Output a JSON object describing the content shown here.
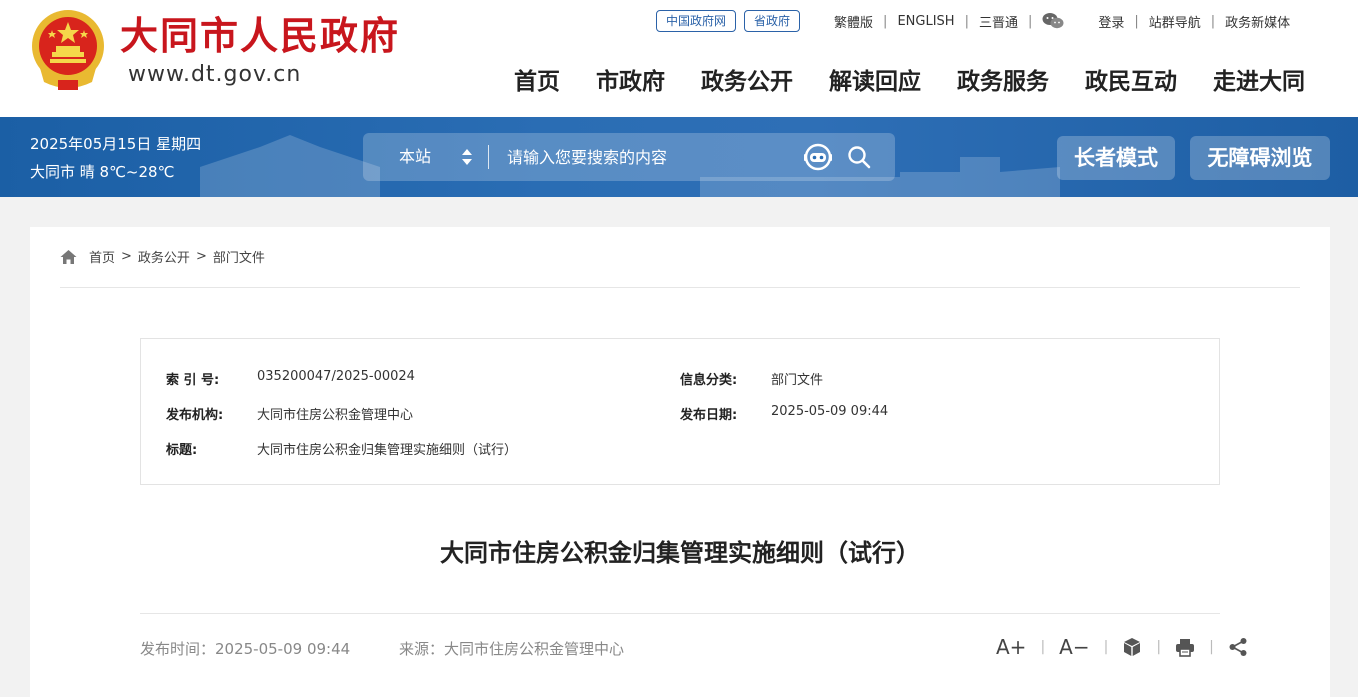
{
  "header": {
    "site_name": "大同市人民政府",
    "site_url": "www.dt.gov.cn",
    "links": {
      "gov_cn": "中国政府网",
      "province_gov": "省政府",
      "traditional": "繁體版",
      "english": "ENGLISH",
      "sanjintong": "三晋通",
      "login": "登录",
      "site_nav": "站群导航",
      "new_media": "政务新媒体"
    },
    "nav": [
      "首页",
      "市政府",
      "政务公开",
      "解读回应",
      "政务服务",
      "政民互动",
      "走进大同"
    ]
  },
  "banner": {
    "date": "2025年05月15日 星期四",
    "weather": "大同市 晴 8℃~28℃",
    "search_scope": "本站",
    "search_placeholder": "请输入您要搜索的内容",
    "elder_mode": "长者模式",
    "accessible": "无障碍浏览"
  },
  "breadcrumb": [
    "首页",
    "政务公开",
    "部门文件"
  ],
  "breadcrumb_sep": ">",
  "meta": {
    "index_no_label": "索 引 号:",
    "index_no": "035200047/2025-00024",
    "category_label": "信息分类:",
    "category": "部门文件",
    "publisher_label": "发布机构:",
    "publisher": "大同市住房公积金管理中心",
    "date_label": "发布日期:",
    "date": "2025-05-09 09:44",
    "title_label": "标题:",
    "title": "大同市住房公积金归集管理实施细则（试行）"
  },
  "article": {
    "title": "大同市住房公积金归集管理实施细则（试行）",
    "publish_time": "发布时间：2025-05-09 09:44",
    "source": "来源：大同市住房公积金管理中心"
  },
  "tools": {
    "font_larger": "A+",
    "font_smaller": "A−"
  },
  "colors": {
    "brand_red": "#c8161d",
    "banner_blue": "#1f63ab"
  }
}
